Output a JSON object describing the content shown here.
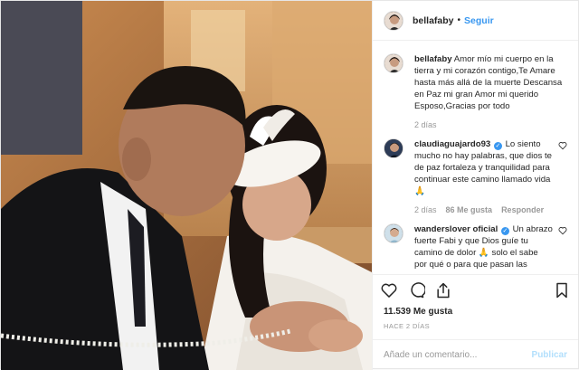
{
  "post": {
    "author": "bellafaby",
    "follow_label": "Seguir",
    "separator": "•",
    "likes": "11.539 Me gusta",
    "time_ago": "HACE 2 DÍAS",
    "comment_placeholder": "Añade un comentario...",
    "publish_label": "Publicar"
  },
  "comments": [
    {
      "user": "bellafaby",
      "verified": false,
      "text": "Amor mío mi cuerpo en la tierra y mi corazón contigo,Te Amare hasta más allá de la muerte Descansa en Paz mi gran Amor mi querido Esposo,Gracias por todo",
      "time": "2 días",
      "likes": "",
      "reply": ""
    },
    {
      "user": "claudiaguajardo93",
      "verified": true,
      "text": "Lo siento mucho no hay palabras, que dios te de paz fortaleza y tranquilidad para continuar este camino llamado vida 🙏",
      "time": "2 días",
      "likes": "86 Me gusta",
      "reply": "Responder"
    },
    {
      "user": "wanderslover oficial",
      "verified": true,
      "text": "Un abrazo fuerte Fabi y que Dios guíe tu camino de dolor 🙏 solo el sabe por qué o para que pasan las cosas.",
      "time": "",
      "likes": "",
      "reply": ""
    }
  ],
  "icons": {
    "like": "heart-icon",
    "comment": "comment-icon",
    "share": "share-icon",
    "save": "bookmark-icon",
    "verified": "verified-badge-icon"
  },
  "colors": {
    "link": "#3897f0",
    "publish_disabled": "#b2dffc",
    "muted": "#999999",
    "text": "#262626"
  }
}
